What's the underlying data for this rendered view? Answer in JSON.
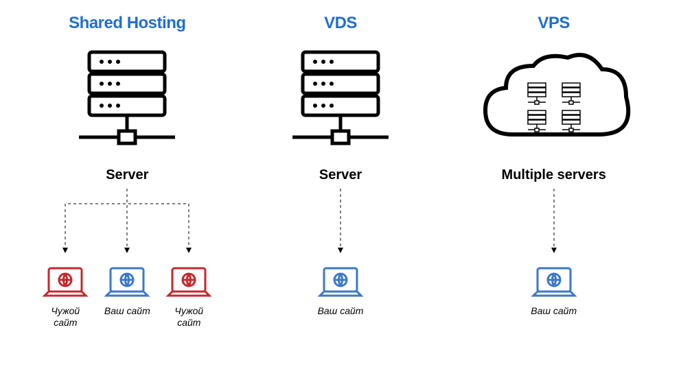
{
  "titles": {
    "shared": "Shared Hosting",
    "vds": "VDS",
    "vps": "VPS"
  },
  "labels": {
    "server": "Server",
    "multiple": "Multiple servers"
  },
  "sites": {
    "foreign": "Чужой\nсайт",
    "yours": "Ваш сайт"
  },
  "colors": {
    "title": "#1f6fd1",
    "red": "#c4282c",
    "blue": "#3a78c8",
    "black": "#000000"
  }
}
